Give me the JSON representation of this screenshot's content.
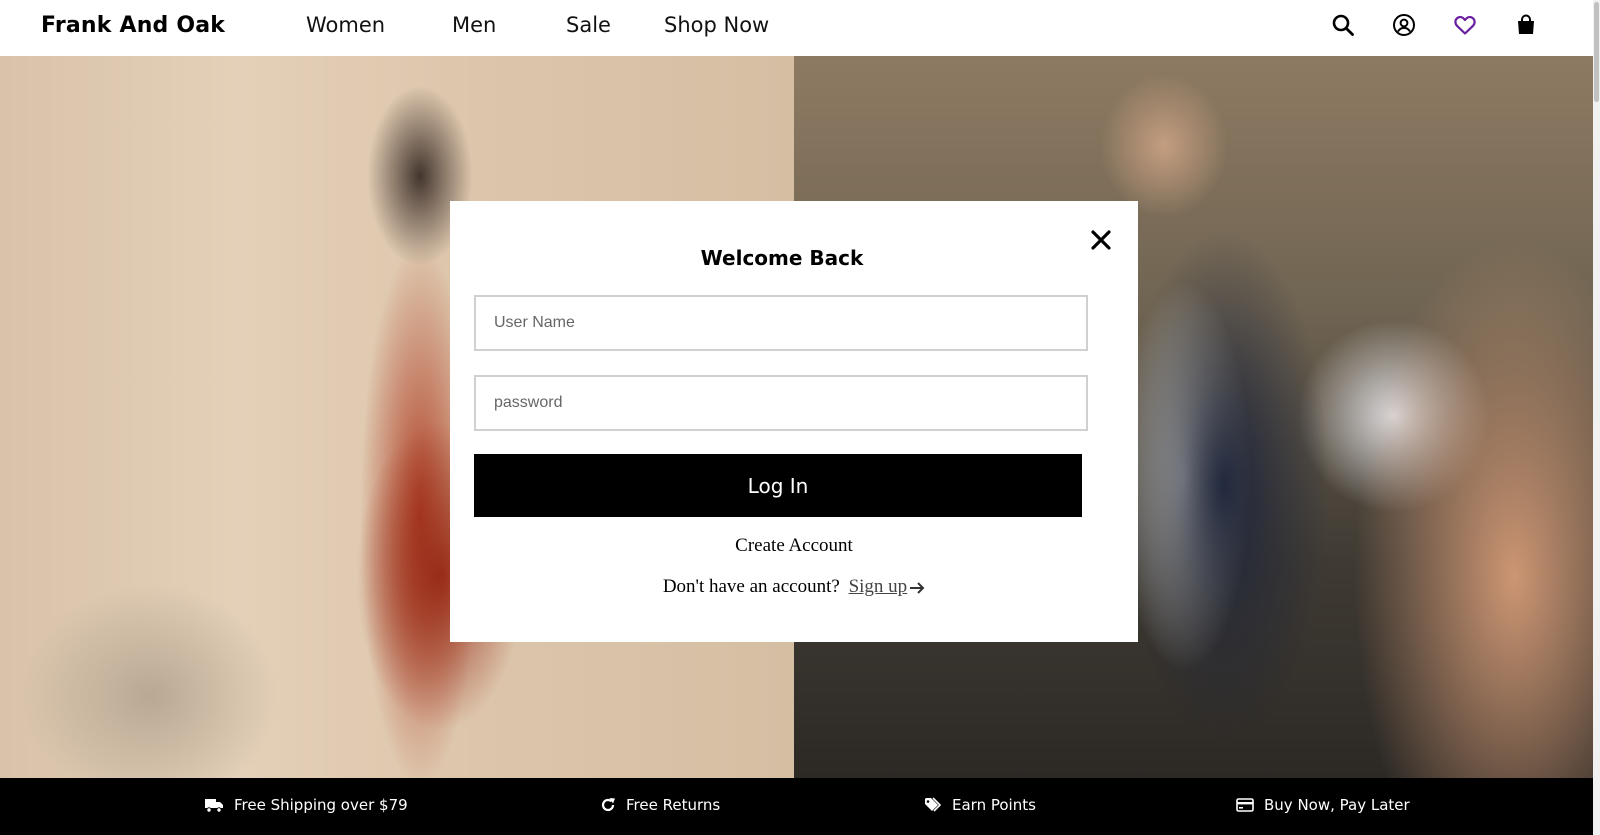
{
  "header": {
    "logo": "Frank And Oak",
    "nav": [
      {
        "label": "Women"
      },
      {
        "label": "Men"
      },
      {
        "label": "Sale"
      },
      {
        "label": "Shop Now"
      }
    ],
    "icons": [
      "search-icon",
      "account-icon",
      "heart-icon",
      "bag-icon"
    ],
    "wishlist_color": "#6a1fa0"
  },
  "hero": {
    "left_image": "woman-in-red-floral-dress",
    "right_image": "man-in-knit-polo-and-navy-jacket"
  },
  "login_modal": {
    "title": "Welcome Back",
    "username_placeholder": "User Name",
    "password_placeholder": "password",
    "login_label": "Log In",
    "create_account": "Create Account",
    "signup_prompt": "Don't have an account?",
    "signup_link": "Sign up"
  },
  "footer": {
    "perks": [
      {
        "label": "Free Shipping over $79",
        "icon": "truck-icon"
      },
      {
        "label": "Free Returns",
        "icon": "refresh-icon"
      },
      {
        "label": "Earn Points",
        "icon": "tags-icon"
      },
      {
        "label": "Buy Now, Pay Later",
        "icon": "credit-card-icon"
      }
    ]
  }
}
